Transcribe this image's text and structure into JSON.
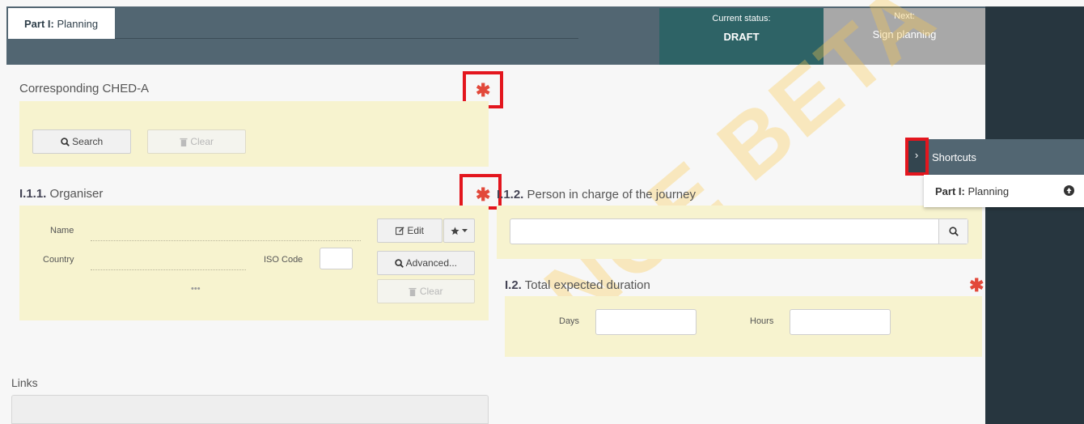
{
  "header": {
    "tab_prefix": "Part I:",
    "tab_label": "Planning",
    "status_label": "Current status:",
    "status_value": "DRAFT",
    "next_label": "Next:",
    "next_value": "Sign planning"
  },
  "ched": {
    "title": "Corresponding CHED-A",
    "search_label": "Search",
    "clear_label": "Clear"
  },
  "organiser": {
    "title_num": "I.1.1.",
    "title": "Organiser",
    "name_label": "Name",
    "country_label": "Country",
    "iso_label": "ISO Code",
    "more": "•••",
    "edit_label": "Edit",
    "advanced_label": "Advanced...",
    "clear_label": "Clear"
  },
  "person": {
    "title_num": "I.1.2.",
    "title": "Person in charge of the journey",
    "input_value": ""
  },
  "duration": {
    "title_num": "I.2.",
    "title": "Total expected duration",
    "days_label": "Days",
    "hours_label": "Hours",
    "days_value": "",
    "hours_value": ""
  },
  "links": {
    "title": "Links"
  },
  "required_mark": "✱",
  "shortcuts": {
    "title": "Shortcuts",
    "item_prefix": "Part I:",
    "item_label": "Planning"
  },
  "watermark": "NCE BETA",
  "colors": {
    "header": "#526672",
    "status": "#2e6366",
    "next": "#a8a8a8",
    "required": "#e2483a",
    "highlight": "#e3161e",
    "panel": "#f7f3cf"
  }
}
